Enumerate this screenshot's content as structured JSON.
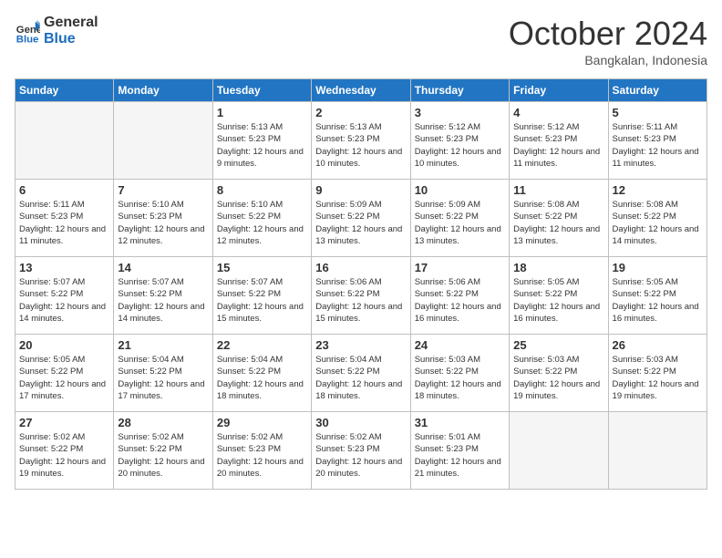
{
  "header": {
    "logo_line1": "General",
    "logo_line2": "Blue",
    "month": "October 2024",
    "location": "Bangkalan, Indonesia"
  },
  "weekdays": [
    "Sunday",
    "Monday",
    "Tuesday",
    "Wednesday",
    "Thursday",
    "Friday",
    "Saturday"
  ],
  "weeks": [
    [
      {
        "day": "",
        "empty": true
      },
      {
        "day": "",
        "empty": true
      },
      {
        "day": "1",
        "sunrise": "Sunrise: 5:13 AM",
        "sunset": "Sunset: 5:23 PM",
        "daylight": "Daylight: 12 hours and 9 minutes."
      },
      {
        "day": "2",
        "sunrise": "Sunrise: 5:13 AM",
        "sunset": "Sunset: 5:23 PM",
        "daylight": "Daylight: 12 hours and 10 minutes."
      },
      {
        "day": "3",
        "sunrise": "Sunrise: 5:12 AM",
        "sunset": "Sunset: 5:23 PM",
        "daylight": "Daylight: 12 hours and 10 minutes."
      },
      {
        "day": "4",
        "sunrise": "Sunrise: 5:12 AM",
        "sunset": "Sunset: 5:23 PM",
        "daylight": "Daylight: 12 hours and 11 minutes."
      },
      {
        "day": "5",
        "sunrise": "Sunrise: 5:11 AM",
        "sunset": "Sunset: 5:23 PM",
        "daylight": "Daylight: 12 hours and 11 minutes."
      }
    ],
    [
      {
        "day": "6",
        "sunrise": "Sunrise: 5:11 AM",
        "sunset": "Sunset: 5:23 PM",
        "daylight": "Daylight: 12 hours and 11 minutes."
      },
      {
        "day": "7",
        "sunrise": "Sunrise: 5:10 AM",
        "sunset": "Sunset: 5:23 PM",
        "daylight": "Daylight: 12 hours and 12 minutes."
      },
      {
        "day": "8",
        "sunrise": "Sunrise: 5:10 AM",
        "sunset": "Sunset: 5:22 PM",
        "daylight": "Daylight: 12 hours and 12 minutes."
      },
      {
        "day": "9",
        "sunrise": "Sunrise: 5:09 AM",
        "sunset": "Sunset: 5:22 PM",
        "daylight": "Daylight: 12 hours and 13 minutes."
      },
      {
        "day": "10",
        "sunrise": "Sunrise: 5:09 AM",
        "sunset": "Sunset: 5:22 PM",
        "daylight": "Daylight: 12 hours and 13 minutes."
      },
      {
        "day": "11",
        "sunrise": "Sunrise: 5:08 AM",
        "sunset": "Sunset: 5:22 PM",
        "daylight": "Daylight: 12 hours and 13 minutes."
      },
      {
        "day": "12",
        "sunrise": "Sunrise: 5:08 AM",
        "sunset": "Sunset: 5:22 PM",
        "daylight": "Daylight: 12 hours and 14 minutes."
      }
    ],
    [
      {
        "day": "13",
        "sunrise": "Sunrise: 5:07 AM",
        "sunset": "Sunset: 5:22 PM",
        "daylight": "Daylight: 12 hours and 14 minutes."
      },
      {
        "day": "14",
        "sunrise": "Sunrise: 5:07 AM",
        "sunset": "Sunset: 5:22 PM",
        "daylight": "Daylight: 12 hours and 14 minutes."
      },
      {
        "day": "15",
        "sunrise": "Sunrise: 5:07 AM",
        "sunset": "Sunset: 5:22 PM",
        "daylight": "Daylight: 12 hours and 15 minutes."
      },
      {
        "day": "16",
        "sunrise": "Sunrise: 5:06 AM",
        "sunset": "Sunset: 5:22 PM",
        "daylight": "Daylight: 12 hours and 15 minutes."
      },
      {
        "day": "17",
        "sunrise": "Sunrise: 5:06 AM",
        "sunset": "Sunset: 5:22 PM",
        "daylight": "Daylight: 12 hours and 16 minutes."
      },
      {
        "day": "18",
        "sunrise": "Sunrise: 5:05 AM",
        "sunset": "Sunset: 5:22 PM",
        "daylight": "Daylight: 12 hours and 16 minutes."
      },
      {
        "day": "19",
        "sunrise": "Sunrise: 5:05 AM",
        "sunset": "Sunset: 5:22 PM",
        "daylight": "Daylight: 12 hours and 16 minutes."
      }
    ],
    [
      {
        "day": "20",
        "sunrise": "Sunrise: 5:05 AM",
        "sunset": "Sunset: 5:22 PM",
        "daylight": "Daylight: 12 hours and 17 minutes."
      },
      {
        "day": "21",
        "sunrise": "Sunrise: 5:04 AM",
        "sunset": "Sunset: 5:22 PM",
        "daylight": "Daylight: 12 hours and 17 minutes."
      },
      {
        "day": "22",
        "sunrise": "Sunrise: 5:04 AM",
        "sunset": "Sunset: 5:22 PM",
        "daylight": "Daylight: 12 hours and 18 minutes."
      },
      {
        "day": "23",
        "sunrise": "Sunrise: 5:04 AM",
        "sunset": "Sunset: 5:22 PM",
        "daylight": "Daylight: 12 hours and 18 minutes."
      },
      {
        "day": "24",
        "sunrise": "Sunrise: 5:03 AM",
        "sunset": "Sunset: 5:22 PM",
        "daylight": "Daylight: 12 hours and 18 minutes."
      },
      {
        "day": "25",
        "sunrise": "Sunrise: 5:03 AM",
        "sunset": "Sunset: 5:22 PM",
        "daylight": "Daylight: 12 hours and 19 minutes."
      },
      {
        "day": "26",
        "sunrise": "Sunrise: 5:03 AM",
        "sunset": "Sunset: 5:22 PM",
        "daylight": "Daylight: 12 hours and 19 minutes."
      }
    ],
    [
      {
        "day": "27",
        "sunrise": "Sunrise: 5:02 AM",
        "sunset": "Sunset: 5:22 PM",
        "daylight": "Daylight: 12 hours and 19 minutes."
      },
      {
        "day": "28",
        "sunrise": "Sunrise: 5:02 AM",
        "sunset": "Sunset: 5:22 PM",
        "daylight": "Daylight: 12 hours and 20 minutes."
      },
      {
        "day": "29",
        "sunrise": "Sunrise: 5:02 AM",
        "sunset": "Sunset: 5:23 PM",
        "daylight": "Daylight: 12 hours and 20 minutes."
      },
      {
        "day": "30",
        "sunrise": "Sunrise: 5:02 AM",
        "sunset": "Sunset: 5:23 PM",
        "daylight": "Daylight: 12 hours and 20 minutes."
      },
      {
        "day": "31",
        "sunrise": "Sunrise: 5:01 AM",
        "sunset": "Sunset: 5:23 PM",
        "daylight": "Daylight: 12 hours and 21 minutes."
      },
      {
        "day": "",
        "empty": true
      },
      {
        "day": "",
        "empty": true
      }
    ]
  ]
}
